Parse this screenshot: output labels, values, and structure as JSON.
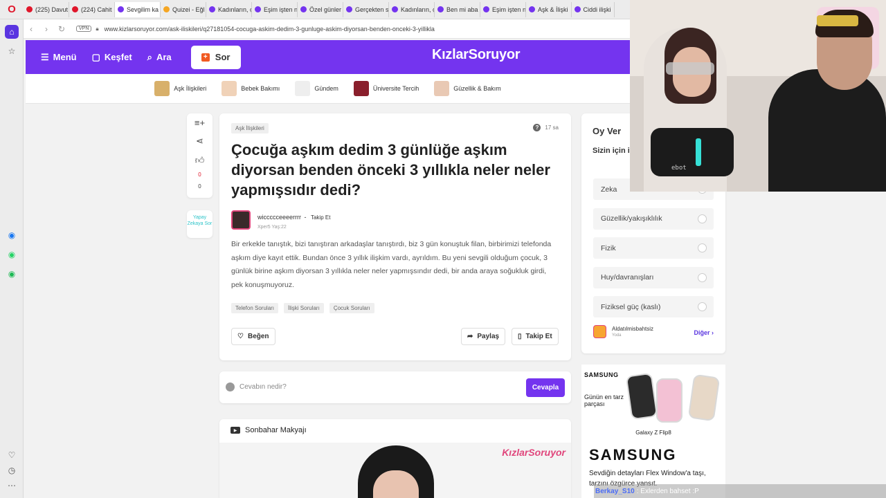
{
  "browser": {
    "tabs": [
      {
        "label": "(225) Davut",
        "color": "#e0172b"
      },
      {
        "label": "(224) Cahit",
        "color": "#e0172b"
      },
      {
        "label": "Sevgilim ka",
        "color": "#7434ef"
      },
      {
        "label": "Quizei - Eğl",
        "color": "#f5a623"
      },
      {
        "label": "Kadınların, ç",
        "color": "#7434ef"
      },
      {
        "label": "Eşim işten n",
        "color": "#7434ef"
      },
      {
        "label": "Özel günler",
        "color": "#7434ef"
      },
      {
        "label": "Gerçekten s",
        "color": "#7434ef"
      },
      {
        "label": "Kadınların, ç",
        "color": "#7434ef"
      },
      {
        "label": "Ben mi aba",
        "color": "#7434ef"
      },
      {
        "label": "Eşim işten n",
        "color": "#7434ef"
      },
      {
        "label": "Aşk & İlişki",
        "color": "#7434ef"
      },
      {
        "label": "Ciddi ilişki",
        "color": "#7434ef"
      }
    ],
    "vpn_label": "VPN",
    "url": "www.kizlarsoruyor.com/ask-iliskileri/q27181054-cocuga-askim-dedim-3-gunluge-askim-diyorsan-benden-onceki-3-yillikla"
  },
  "site": {
    "brand": "KızlarSoruyor",
    "nav": {
      "menu": "Menü",
      "explore": "Keşfet",
      "search": "Ara",
      "ask": "Sor"
    },
    "categories": [
      {
        "label": "Aşk İlişkileri",
        "color": "#d8b06a"
      },
      {
        "label": "Bebek Bakımı",
        "color": "#f0d2b8"
      },
      {
        "label": "Gündem",
        "color": "#eeeeee"
      },
      {
        "label": "Üniversite Tercih",
        "color": "#8a1f2c"
      },
      {
        "label": "Güzellik & Bakım",
        "color": "#e9c9b4"
      }
    ]
  },
  "rail": {
    "likes": "0",
    "comments": "0",
    "ai_label": "Yapay Zekaya Sor"
  },
  "question": {
    "category": "Aşk İlişkileri",
    "time": "17 sa",
    "title": "Çocuğa aşkım dedim 3 günlüğe aşkım diyorsan benden önceki 3 yıllıkla neler neler yapmışsıdır dedi?",
    "author": "wiccccceeeerrrr",
    "follow": "Takip Et",
    "author_meta": "Xper5  Yaş:22",
    "body": "Bir erkekle tanıştık, bizi tanıştıran arkadaşlar tanıştırdı, biz 3 gün konuştuk filan, birbirimizi telefonda aşkım diye kayıt ettik. Bundan önce 3 yıllık ilişkim vardı, ayrıldım. Bu yeni sevgili olduğum çocuk, 3 günlük birine aşkım diyorsan 3 yıllıkla neler neler yapmışsındır dedi, bir anda araya soğukluk girdi, pek konuşmuyoruz.",
    "tags": [
      "Telefon Soruları",
      "İlişki Soruları",
      "Çocuk Soruları"
    ],
    "actions": {
      "like": "Beğen",
      "share": "Paylaş",
      "follow": "Takip Et"
    }
  },
  "answer": {
    "placeholder": "Cevabın nedir?",
    "submit": "Cevapla"
  },
  "video": {
    "title": "Sonbahar Makyajı",
    "logo": "KızlarSoruyor"
  },
  "poll": {
    "title": "Oy Ver",
    "question": "Sizin için insanda h",
    "options": [
      "Zeka",
      "Güzellik/yakışıklılık",
      "Fizik",
      "Huy/davranışları",
      "Fiziksel güç (kaslı)"
    ],
    "author": "Aldatılmisbahtsiz",
    "author_meta": "Yoda",
    "more": "Diğer"
  },
  "ad": {
    "brand_small": "SAMSUNG",
    "slogan": "Günün en tarz parçası",
    "model": "Galaxy Z Flip8",
    "brand_big": "SAMSUNG",
    "description": "Sevdiğin detayları Flex Window'a taşı, tarzını özgürce yansıt."
  },
  "webcam": {
    "mic_brand": "ebot"
  },
  "chat": {
    "user": "Berkay_S10",
    "message": ": Exlerden bahset :P"
  }
}
